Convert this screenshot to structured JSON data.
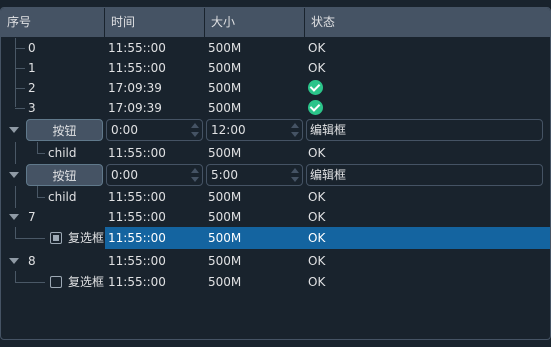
{
  "headers": [
    "序号",
    "时间",
    "大小",
    "状态"
  ],
  "rows": [
    {
      "id": "0",
      "time": "11:55::00",
      "size": "500M",
      "status": "OK"
    },
    {
      "id": "1",
      "time": "11:55::00",
      "size": "500M",
      "status": "OK"
    },
    {
      "id": "2",
      "time": "17:09:39",
      "size": "500M",
      "status_icon": "check-circle-icon"
    },
    {
      "id": "3",
      "time": "17:09:39",
      "size": "500M",
      "status_icon": "check-circle-icon"
    },
    {
      "button": "按钮",
      "spin1": "0:00",
      "spin2": "12:00",
      "edit": "编辑框"
    },
    {
      "id": "child",
      "time": "11:55::00",
      "size": "500M",
      "status": "OK"
    },
    {
      "button": "按钮",
      "spin1": "0:00",
      "spin2": "5:00",
      "edit": "编辑框"
    },
    {
      "id": "child",
      "time": "11:55::00",
      "size": "500M",
      "status": "OK"
    },
    {
      "id": "7",
      "time": "11:55::00",
      "size": "500M",
      "status": "OK"
    },
    {
      "checkbox": "复选框",
      "checked": true,
      "time": "11:55::00",
      "size": "500M",
      "status": "OK",
      "selected": true
    },
    {
      "id": "8",
      "time": "11:55::00",
      "size": "500M",
      "status": "OK"
    },
    {
      "checkbox": "复选框",
      "checked": false,
      "time": "11:55::00",
      "size": "500M",
      "status": "OK"
    }
  ],
  "colors": {
    "background": "#19232d",
    "header": "#455364",
    "selected": "#1464a0",
    "ok_icon": "#2bc48a"
  }
}
